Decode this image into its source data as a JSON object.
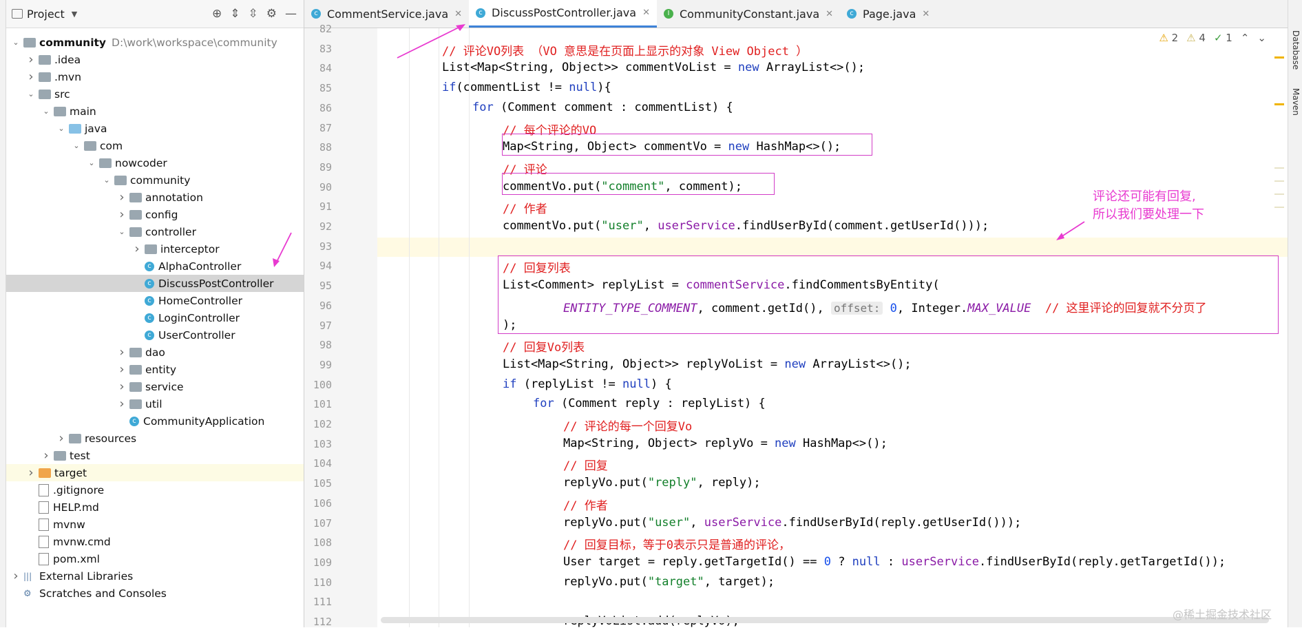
{
  "project": {
    "title": "Project",
    "tree": [
      {
        "label": "community",
        "path": "D:\\work\\workspace\\community",
        "indent": 0,
        "arrow": "open",
        "icon": "folder",
        "bold": true
      },
      {
        "label": ".idea",
        "indent": 1,
        "arrow": "closed",
        "icon": "folder"
      },
      {
        "label": ".mvn",
        "indent": 1,
        "arrow": "closed",
        "icon": "folder"
      },
      {
        "label": "src",
        "indent": 1,
        "arrow": "open",
        "icon": "folder"
      },
      {
        "label": "main",
        "indent": 2,
        "arrow": "open",
        "icon": "folder"
      },
      {
        "label": "java",
        "indent": 3,
        "arrow": "open",
        "icon": "folder-blue"
      },
      {
        "label": "com",
        "indent": 4,
        "arrow": "open",
        "icon": "folder"
      },
      {
        "label": "nowcoder",
        "indent": 5,
        "arrow": "open",
        "icon": "folder"
      },
      {
        "label": "community",
        "indent": 6,
        "arrow": "open",
        "icon": "folder"
      },
      {
        "label": "annotation",
        "indent": 7,
        "arrow": "closed",
        "icon": "folder"
      },
      {
        "label": "config",
        "indent": 7,
        "arrow": "closed",
        "icon": "folder"
      },
      {
        "label": "controller",
        "indent": 7,
        "arrow": "open",
        "icon": "folder"
      },
      {
        "label": "interceptor",
        "indent": 8,
        "arrow": "closed",
        "icon": "folder"
      },
      {
        "label": "AlphaController",
        "indent": 8,
        "arrow": "none",
        "icon": "class"
      },
      {
        "label": "DiscussPostController",
        "indent": 8,
        "arrow": "none",
        "icon": "class",
        "selected": true
      },
      {
        "label": "HomeController",
        "indent": 8,
        "arrow": "none",
        "icon": "class"
      },
      {
        "label": "LoginController",
        "indent": 8,
        "arrow": "none",
        "icon": "class"
      },
      {
        "label": "UserController",
        "indent": 8,
        "arrow": "none",
        "icon": "class"
      },
      {
        "label": "dao",
        "indent": 7,
        "arrow": "closed",
        "icon": "folder"
      },
      {
        "label": "entity",
        "indent": 7,
        "arrow": "closed",
        "icon": "folder"
      },
      {
        "label": "service",
        "indent": 7,
        "arrow": "closed",
        "icon": "folder"
      },
      {
        "label": "util",
        "indent": 7,
        "arrow": "closed",
        "icon": "folder"
      },
      {
        "label": "CommunityApplication",
        "indent": 7,
        "arrow": "none",
        "icon": "class"
      },
      {
        "label": "resources",
        "indent": 3,
        "arrow": "closed",
        "icon": "folder"
      },
      {
        "label": "test",
        "indent": 2,
        "arrow": "closed",
        "icon": "folder"
      },
      {
        "label": "target",
        "indent": 1,
        "arrow": "closed",
        "icon": "folder-orange",
        "highlight": true
      },
      {
        "label": ".gitignore",
        "indent": 1,
        "arrow": "none",
        "icon": "file"
      },
      {
        "label": "HELP.md",
        "indent": 1,
        "arrow": "none",
        "icon": "file"
      },
      {
        "label": "mvnw",
        "indent": 1,
        "arrow": "none",
        "icon": "file"
      },
      {
        "label": "mvnw.cmd",
        "indent": 1,
        "arrow": "none",
        "icon": "file"
      },
      {
        "label": "pom.xml",
        "indent": 1,
        "arrow": "none",
        "icon": "file"
      },
      {
        "label": "External Libraries",
        "indent": 0,
        "arrow": "closed",
        "icon": "lib"
      },
      {
        "label": "Scratches and Consoles",
        "indent": 0,
        "arrow": "none",
        "icon": "scratch"
      }
    ]
  },
  "tabs": [
    {
      "label": "CommentService.java",
      "icon": "C"
    },
    {
      "label": "DiscussPostController.java",
      "icon": "C",
      "active": true
    },
    {
      "label": "CommunityConstant.java",
      "icon": "I"
    },
    {
      "label": "Page.java",
      "icon": "C"
    }
  ],
  "inspections": {
    "warn_a": "2",
    "warn_b": "4",
    "ok": "1"
  },
  "side_tools": [
    "Database",
    "Maven"
  ],
  "annotation": {
    "line1": "评论还可能有回复,",
    "line2": "所以我们要处理一下"
  },
  "watermark": "@稀土掘金技术社区",
  "code": [
    {
      "n": "82",
      "indent": 0,
      "html": ""
    },
    {
      "n": "83",
      "indent": 0,
      "html": "<span class='cm'>// 评论VO列表 （VO 意思是在页面上显示的对象 View Object ）</span>"
    },
    {
      "n": "84",
      "indent": 0,
      "html": "List&lt;Map&lt;String, Object&gt;&gt; commentVoList = <span class='kw'>new</span> ArrayList&lt;&gt;();"
    },
    {
      "n": "85",
      "indent": 0,
      "html": "<span class='kw'>if</span>(commentList != <span class='kw'>null</span>){"
    },
    {
      "n": "86",
      "indent": 1,
      "html": "<span class='kw'>for</span> (Comment comment : commentList) {"
    },
    {
      "n": "87",
      "indent": 2,
      "html": "<span class='cm'>// 每个评论的VO</span>"
    },
    {
      "n": "88",
      "indent": 2,
      "html": "Map&lt;String, Object&gt; commentVo = <span class='kw'>new</span> HashMap&lt;&gt;();"
    },
    {
      "n": "89",
      "indent": 2,
      "html": "<span class='cm'>// 评论</span>"
    },
    {
      "n": "90",
      "indent": 2,
      "html": "commentVo.put(<span class='str'>\"comment\"</span>, comment);"
    },
    {
      "n": "91",
      "indent": 2,
      "html": "<span class='cm'>// 作者</span>"
    },
    {
      "n": "92",
      "indent": 2,
      "html": "commentVo.put(<span class='str'>\"user\"</span>, <span class='svc'>userService</span>.findUserById(comment.getUserId()));"
    },
    {
      "n": "93",
      "indent": 2,
      "html": "",
      "current": true
    },
    {
      "n": "94",
      "indent": 2,
      "html": "<span class='cm'>// 回复列表</span>"
    },
    {
      "n": "95",
      "indent": 2,
      "html": "List&lt;Comment&gt; replyList = <span class='svc'>commentService</span>.findCommentsByEntity("
    },
    {
      "n": "96",
      "indent": 4,
      "html": "<span class='fld'>ENTITY_TYPE_COMMENT</span>, comment.getId(), <span class='hint'>offset:</span> <span class='num'>0</span>, Integer.<span class='fld'>MAX_VALUE</span>  <span class='cm'>// 这里评论的回复就不分页了</span>"
    },
    {
      "n": "97",
      "indent": 2,
      "html": ");"
    },
    {
      "n": "98",
      "indent": 2,
      "html": "<span class='cm'>// 回复Vo列表</span>"
    },
    {
      "n": "99",
      "indent": 2,
      "html": "List&lt;Map&lt;String, Object&gt;&gt; replyVoList = <span class='kw'>new</span> ArrayList&lt;&gt;();"
    },
    {
      "n": "100",
      "indent": 2,
      "html": "<span class='kw'>if</span> (replyList != <span class='kw'>null</span>) {"
    },
    {
      "n": "101",
      "indent": 3,
      "html": "<span class='kw'>for</span> (Comment reply : replyList) {"
    },
    {
      "n": "102",
      "indent": 4,
      "html": "<span class='cm'>// 评论的每一个回复Vo</span>"
    },
    {
      "n": "103",
      "indent": 4,
      "html": "Map&lt;String, Object&gt; replyVo = <span class='kw'>new</span> HashMap&lt;&gt;();"
    },
    {
      "n": "104",
      "indent": 4,
      "html": "<span class='cm'>// 回复</span>"
    },
    {
      "n": "105",
      "indent": 4,
      "html": "replyVo.put(<span class='str'>\"reply\"</span>, reply);"
    },
    {
      "n": "106",
      "indent": 4,
      "html": "<span class='cm'>// 作者</span>"
    },
    {
      "n": "107",
      "indent": 4,
      "html": "replyVo.put(<span class='str'>\"user\"</span>, <span class='svc'>userService</span>.findUserById(reply.getUserId()));"
    },
    {
      "n": "108",
      "indent": 4,
      "html": "<span class='cm'>// 回复目标，等于0表示只是普通的评论，</span>"
    },
    {
      "n": "109",
      "indent": 4,
      "html": "User target = reply.getTargetId() == <span class='num'>0</span> ? <span class='kw'>null</span> : <span class='svc'>userService</span>.findUserById(reply.getTargetId());"
    },
    {
      "n": "110",
      "indent": 4,
      "html": "replyVo.put(<span class='str'>\"target\"</span>, target);"
    },
    {
      "n": "111",
      "indent": 4,
      "html": ""
    },
    {
      "n": "112",
      "indent": 4,
      "html": "replyVoList.add(replyVo);"
    }
  ]
}
